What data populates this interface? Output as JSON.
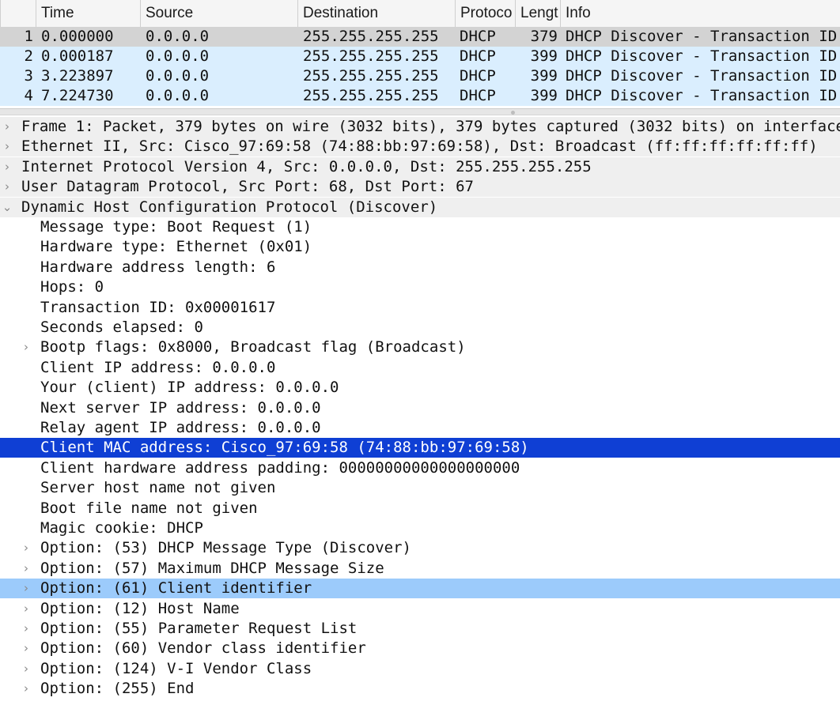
{
  "packet_list": {
    "columns": [
      "",
      "Time",
      "Source",
      "Destination",
      "Protoco",
      "Lengt",
      "Info"
    ],
    "rows": [
      {
        "no": "1",
        "time": "0.000000",
        "source": "0.0.0.0",
        "destination": "255.255.255.255",
        "protocol": "DHCP",
        "length": "379",
        "info": "DHCP Discover - Transaction ID"
      },
      {
        "no": "2",
        "time": "0.000187",
        "source": "0.0.0.0",
        "destination": "255.255.255.255",
        "protocol": "DHCP",
        "length": "399",
        "info": "DHCP Discover - Transaction ID"
      },
      {
        "no": "3",
        "time": "3.223897",
        "source": "0.0.0.0",
        "destination": "255.255.255.255",
        "protocol": "DHCP",
        "length": "399",
        "info": "DHCP Discover - Transaction ID"
      },
      {
        "no": "4",
        "time": "7.224730",
        "source": "0.0.0.0",
        "destination": "255.255.255.255",
        "protocol": "DHCP",
        "length": "399",
        "info": "DHCP Discover - Transaction ID"
      }
    ]
  },
  "details": {
    "items": [
      {
        "text": "Frame 1: Packet, 379 bytes on wire (3032 bits), 379 bytes captured (3032 bits) on interface",
        "level": 0,
        "arrow": "collapsed",
        "style": "top"
      },
      {
        "text": "Ethernet II, Src: Cisco_97:69:58 (74:88:bb:97:69:58), Dst: Broadcast (ff:ff:ff:ff:ff:ff)",
        "level": 0,
        "arrow": "collapsed",
        "style": "top"
      },
      {
        "text": "Internet Protocol Version 4, Src: 0.0.0.0, Dst: 255.255.255.255",
        "level": 0,
        "arrow": "collapsed",
        "style": "top"
      },
      {
        "text": "User Datagram Protocol, Src Port: 68, Dst Port: 67",
        "level": 0,
        "arrow": "collapsed",
        "style": "top"
      },
      {
        "text": "Dynamic Host Configuration Protocol (Discover)",
        "level": 0,
        "arrow": "expanded",
        "style": "top"
      },
      {
        "text": "Message type: Boot Request (1)",
        "level": 1,
        "arrow": "none",
        "style": "plain"
      },
      {
        "text": "Hardware type: Ethernet (0x01)",
        "level": 1,
        "arrow": "none",
        "style": "plain"
      },
      {
        "text": "Hardware address length: 6",
        "level": 1,
        "arrow": "none",
        "style": "plain"
      },
      {
        "text": "Hops: 0",
        "level": 1,
        "arrow": "none",
        "style": "plain"
      },
      {
        "text": "Transaction ID: 0x00001617",
        "level": 1,
        "arrow": "none",
        "style": "plain"
      },
      {
        "text": "Seconds elapsed: 0",
        "level": 1,
        "arrow": "none",
        "style": "plain"
      },
      {
        "text": "Bootp flags: 0x8000, Broadcast flag (Broadcast)",
        "level": 1,
        "arrow": "collapsed",
        "style": "plain"
      },
      {
        "text": "Client IP address: 0.0.0.0",
        "level": 1,
        "arrow": "none",
        "style": "plain"
      },
      {
        "text": "Your (client) IP address: 0.0.0.0",
        "level": 1,
        "arrow": "none",
        "style": "plain"
      },
      {
        "text": "Next server IP address: 0.0.0.0",
        "level": 1,
        "arrow": "none",
        "style": "plain"
      },
      {
        "text": "Relay agent IP address: 0.0.0.0",
        "level": 1,
        "arrow": "none",
        "style": "plain"
      },
      {
        "text": "Client MAC address: Cisco_97:69:58 (74:88:bb:97:69:58)",
        "level": 1,
        "arrow": "none",
        "style": "selected"
      },
      {
        "text": "Client hardware address padding: 00000000000000000000",
        "level": 1,
        "arrow": "none",
        "style": "plain"
      },
      {
        "text": "Server host name not given",
        "level": 1,
        "arrow": "none",
        "style": "plain"
      },
      {
        "text": "Boot file name not given",
        "level": 1,
        "arrow": "none",
        "style": "plain"
      },
      {
        "text": "Magic cookie: DHCP",
        "level": 1,
        "arrow": "none",
        "style": "plain"
      },
      {
        "text": "Option: (53) DHCP Message Type (Discover)",
        "level": 1,
        "arrow": "collapsed",
        "style": "plain"
      },
      {
        "text": "Option: (57) Maximum DHCP Message Size",
        "level": 1,
        "arrow": "collapsed",
        "style": "plain"
      },
      {
        "text": "Option: (61) Client identifier",
        "level": 1,
        "arrow": "collapsed",
        "style": "related"
      },
      {
        "text": "Option: (12) Host Name",
        "level": 1,
        "arrow": "collapsed",
        "style": "plain"
      },
      {
        "text": "Option: (55) Parameter Request List",
        "level": 1,
        "arrow": "collapsed",
        "style": "plain"
      },
      {
        "text": "Option: (60) Vendor class identifier",
        "level": 1,
        "arrow": "collapsed",
        "style": "plain"
      },
      {
        "text": "Option: (124) V-I Vendor Class",
        "level": 1,
        "arrow": "collapsed",
        "style": "plain"
      },
      {
        "text": "Option: (255) End",
        "level": 1,
        "arrow": "collapsed",
        "style": "plain"
      }
    ]
  },
  "icons": {
    "collapsed": "chevron-right-icon",
    "expanded": "chevron-down-icon"
  },
  "colors": {
    "packet_selected_bg": "#d3d3d3",
    "packet_row_bg": "#daeefe",
    "detail_top_bg": "#efefef",
    "detail_selected_bg": "#0f3fd4",
    "detail_selected_fg": "#ffffff",
    "detail_related_bg": "#9ccbfb"
  }
}
